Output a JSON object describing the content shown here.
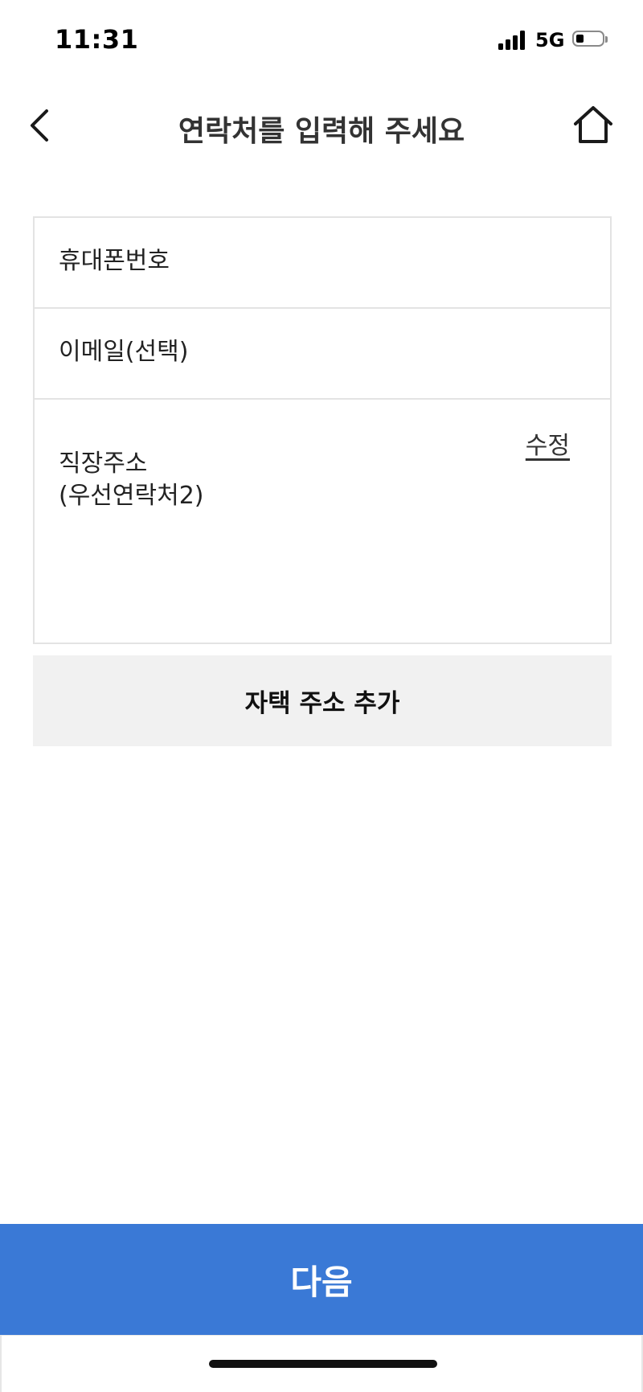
{
  "status_bar": {
    "time": "11:31",
    "network": "5G",
    "battery_level_percent": 30
  },
  "header": {
    "title": "연락처를 입력해 주세요",
    "back_icon": "chevron-left-icon",
    "home_icon": "home-icon"
  },
  "form": {
    "phone_label": "휴대폰번호",
    "email_label": "이메일(선택)",
    "address_label_line1": "직장주소",
    "address_label_line2": "(우선연락처2)",
    "edit_label": "수정"
  },
  "add_home_address_label": "자택 주소 추가",
  "next_label": "다음",
  "colors": {
    "primary": "#3a79d6",
    "secondary_button_bg": "#f1f1f1",
    "border": "#e3e3e3"
  }
}
